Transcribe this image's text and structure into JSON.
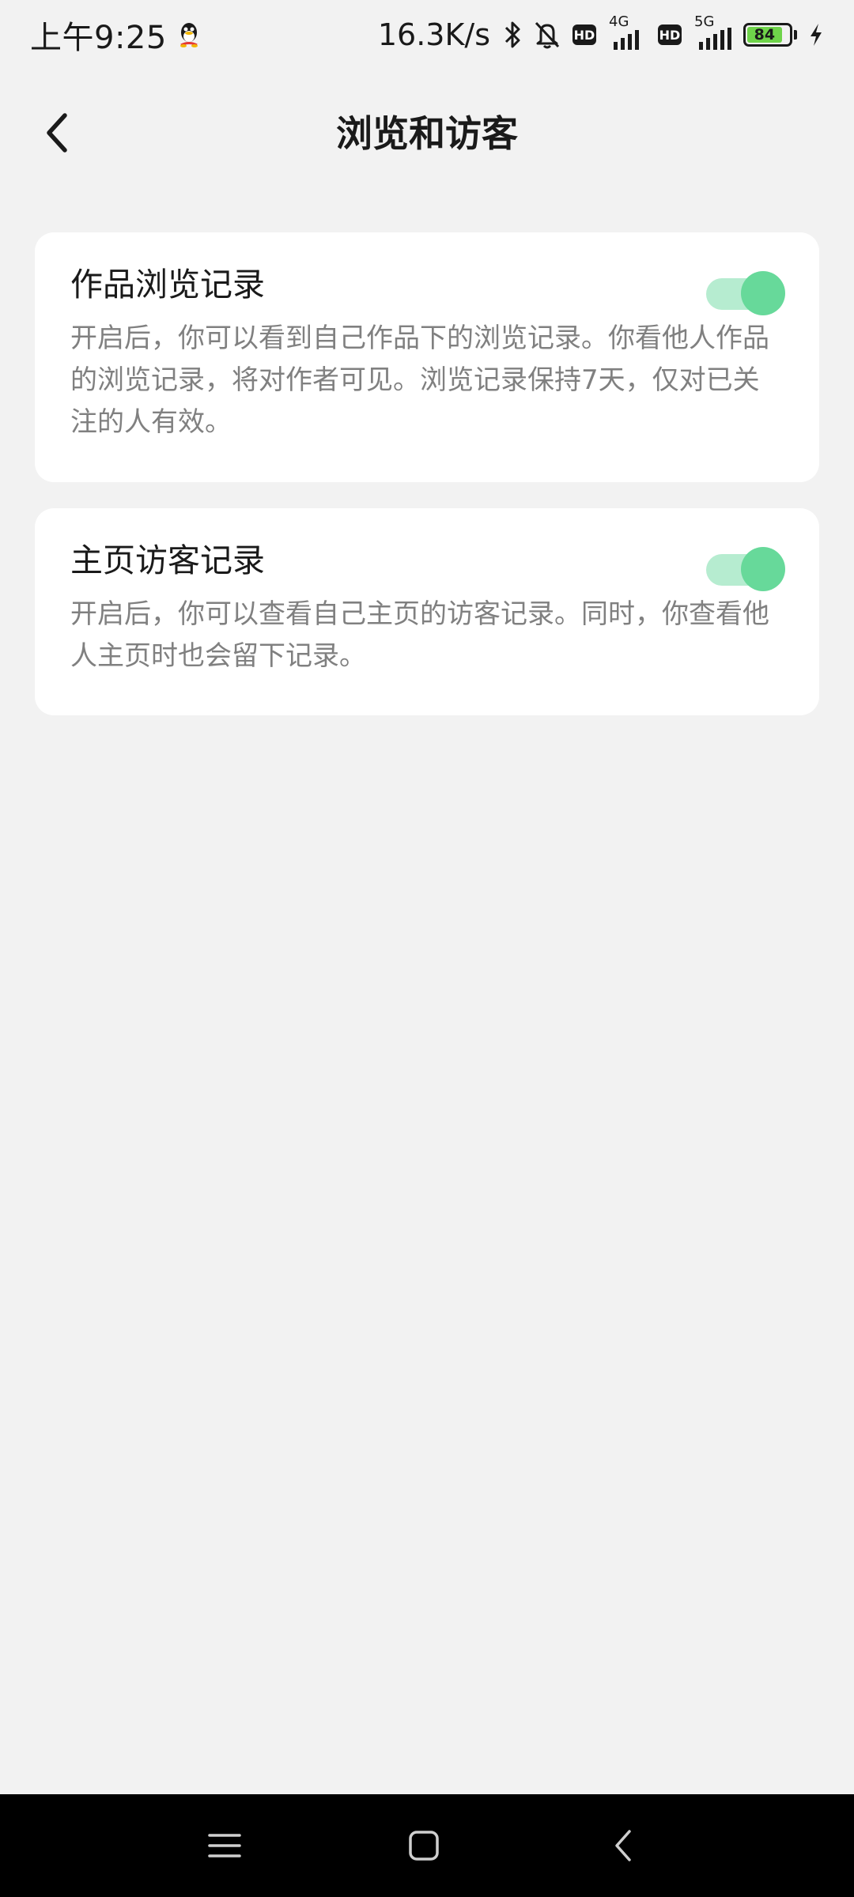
{
  "status_bar": {
    "time": "上午9:25",
    "net_speed": "16.3K/s",
    "sim1_network": "4G",
    "sim2_network": "5G",
    "hd_label": "HD",
    "battery_level": "84",
    "icons": [
      "qq-icon",
      "bluetooth-icon",
      "bell-off-icon",
      "hd-icon",
      "signal-icon",
      "battery-icon",
      "charging-icon"
    ]
  },
  "header": {
    "title": "浏览和访客",
    "back_icon": "chevron-left-icon"
  },
  "settings": [
    {
      "title": "作品浏览记录",
      "description": "开启后，你可以看到自己作品下的浏览记录。你看他人作品的浏览记录，将对作者可见。浏览记录保持7天，仅对已关注的人有效。",
      "enabled": true
    },
    {
      "title": "主页访客记录",
      "description": "开启后，你可以查看自己主页的访客记录。同时，你查看他人主页时也会留下记录。",
      "enabled": true
    }
  ],
  "nav_bar": {
    "buttons": [
      "menu-icon",
      "home-icon",
      "back-icon"
    ]
  },
  "colors": {
    "background": "#f2f2f2",
    "card": "#ffffff",
    "toggle_on_knob": "#67d99a",
    "toggle_on_track": "#b6ecd0",
    "battery_fill": "#6fd44a",
    "description_text": "#808080"
  }
}
